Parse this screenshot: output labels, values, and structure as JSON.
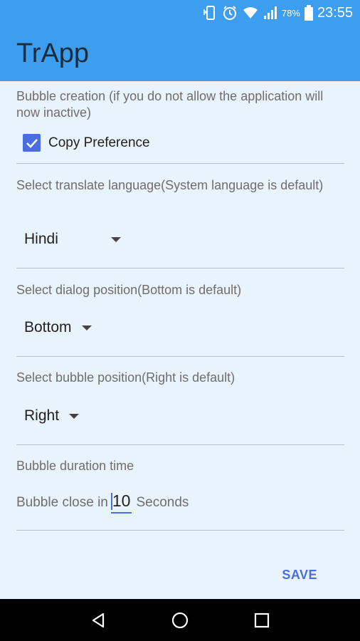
{
  "status_bar": {
    "battery_percent": "78%",
    "time": "23:55",
    "icons": [
      "vibrate-icon",
      "alarm-icon",
      "wifi-icon",
      "signal-icon",
      "battery-icon"
    ]
  },
  "app_bar": {
    "title": "TrApp",
    "color": "#3d9ef0"
  },
  "settings": {
    "bubble_creation_label": "Bubble creation (if you do not allow the application will now inactive)",
    "copy_preference_label": "Copy Preference",
    "copy_preference_checked": true,
    "translate_language_label": "Select translate language(System language is default)",
    "translate_language_value": "Hindi",
    "dialog_position_label": "Select dialog position(Bottom is default)",
    "dialog_position_value": "Bottom",
    "bubble_position_label": "Select bubble position(Right is default)",
    "bubble_position_value": "Right",
    "bubble_duration_label": "Bubble duration time",
    "bubble_close_prefix": "Bubble close in",
    "bubble_close_value": "10",
    "bubble_close_suffix": "Seconds"
  },
  "actions": {
    "save_label": "SAVE",
    "accent_color": "#4a6ee0"
  },
  "nav_bar": {
    "buttons": [
      "back-icon",
      "home-icon",
      "recents-icon"
    ]
  }
}
